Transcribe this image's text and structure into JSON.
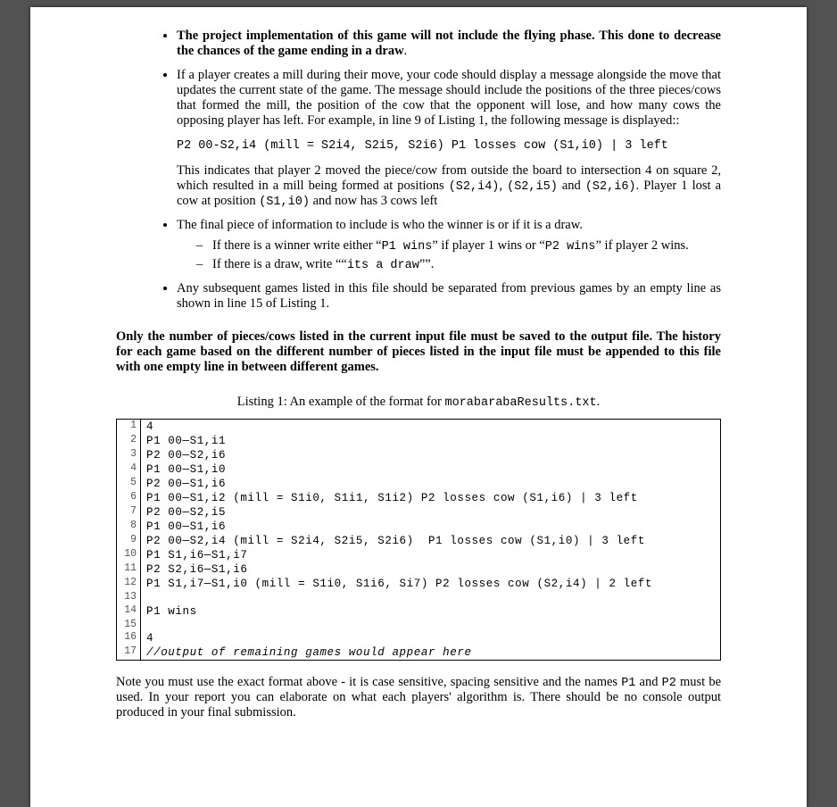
{
  "bullets": {
    "b1": "The project implementation of this game will not include the flying phase. This done to decrease the chances of the game ending in a draw",
    "b2_p1": "If a player creates a mill during their move, your code should display a message alongside the move that updates the current state of the game. The message should include the positions of the three pieces/cows that formed the mill, the position of the cow that the opponent will lose, and how many cows the opposing player has left. For example, in line 9 of Listing 1, the following message is displayed::",
    "b2_code": "P2 00-S2,i4 (mill = S2i4, S2i5, S2i6) P1 losses cow (S1,i0) | 3 left",
    "b2_p2a": "This indicates that player 2 moved the piece/cow from outside the board to intersection 4 on square 2, which resulted in a mill being formed at positions ",
    "b2_p2_code1": "(S2,i4)",
    "b2_p2b": ", ",
    "b2_p2_code2": "(S2,i5)",
    "b2_p2c": " and ",
    "b2_p2_code3": "(S2,i6)",
    "b2_p2d": ". Player 1 lost a cow at position ",
    "b2_p2_code4": "(S1,i0)",
    "b2_p2e": " and now has 3 cows left",
    "b3_intro": "The final piece of information to include is who the winner is or if it is a draw.",
    "b3_d1a": "If there is a winner write either “",
    "b3_d1_code1": "P1 wins",
    "b3_d1b": "” if player 1 wins or “",
    "b3_d1_code2": "P2 wins",
    "b3_d1c": "” if player 2 wins.",
    "b3_d2a": "If there is a draw, write ““",
    "b3_d2_code": "its a draw",
    "b3_d2b": "””.",
    "b4": "Any subsequent games listed in this file should be separated from previous games by an empty line as shown in line 15 of Listing 1."
  },
  "bold_para": "Only the number of pieces/cows listed in the current input file must be saved to the output file. The history for each game based on the different number of pieces listed in the input file must be appended to this file with one empty line in between different games.",
  "listing": {
    "caption_a": "Listing 1: An example of the format for ",
    "caption_code": "morabarabaResults.txt",
    "caption_b": ".",
    "lines": [
      "4",
      "P1 00—S1,i1",
      "P2 00—S2,i6",
      "P1 00—S1,i0",
      "P2 00—S1,i6",
      "P1 00—S1,i2 (mill = S1i0, S1i1, S1i2) P2 losses cow (S1,i6) | 3 left",
      "P2 00—S2,i5",
      "P1 00—S1,i6",
      "P2 00—S2,i4 (mill = S2i4, S2i5, S2i6)  P1 losses cow (S1,i0) | 3 left",
      "P1 S1,i6—S1,i7",
      "P2 S2,i6—S1,i6",
      "P1 S1,i7—S1,i0 (mill = S1i0, S1i6, Si7) P2 losses cow (S2,i4) | 2 left",
      "",
      "P1 wins",
      "",
      "4",
      "//output of remaining games would appear here"
    ],
    "italic_line_index": 16
  },
  "post_note": {
    "a": "Note you must use the exact format above - it is case sensitive, spacing sensitive and the names ",
    "code1": "P1",
    "b": " and ",
    "code2": "P2",
    "c": " must be used. In your report you can elaborate on what each players' algorithm is. There should be no console output produced in your final submission."
  }
}
